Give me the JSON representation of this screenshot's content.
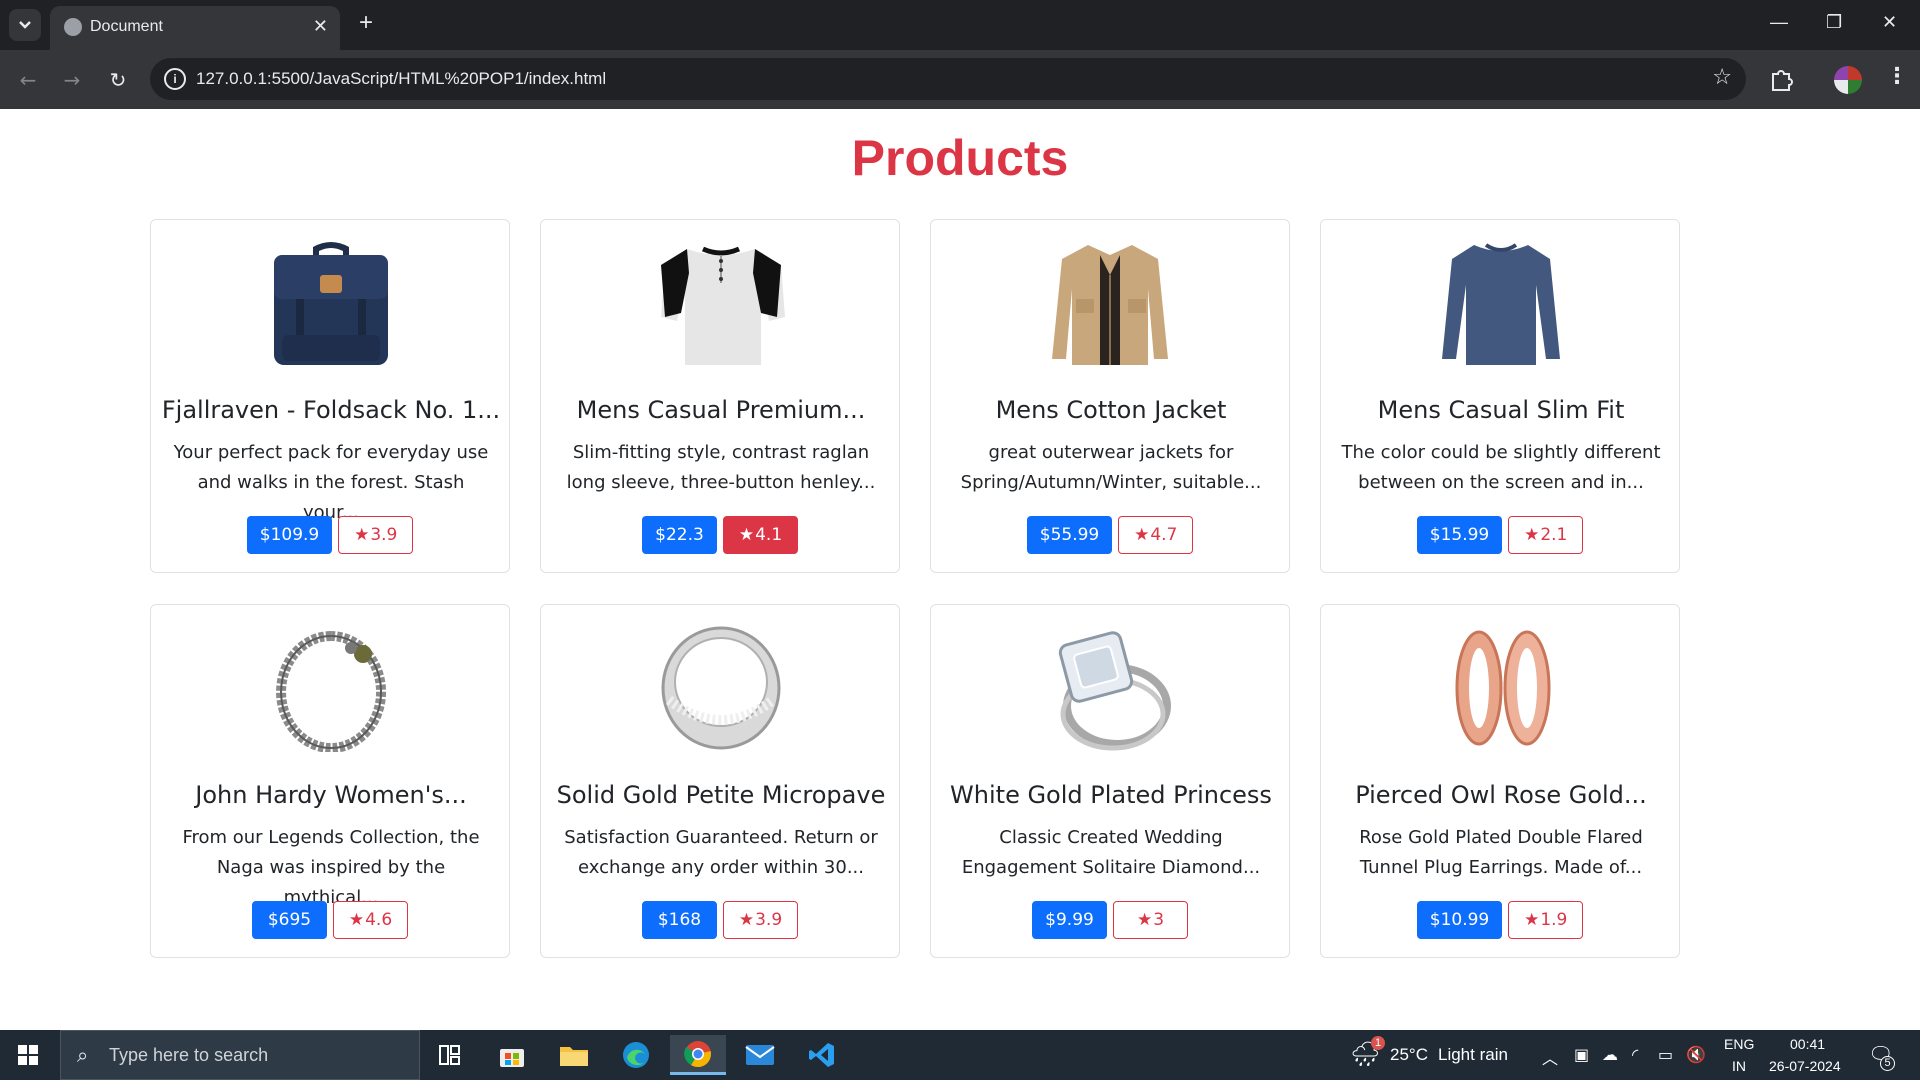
{
  "browser": {
    "tab_title": "Document",
    "url": "127.0.0.1:5500/JavaScript/HTML%20POP1/index.html"
  },
  "page": {
    "title": "Products"
  },
  "products": [
    {
      "title": "Fjallraven - Foldsack No. 1...",
      "desc": "Your perfect pack for everyday use and walks in the forest. Stash your...",
      "price": "$109.9",
      "rating": "3.9",
      "rating_active": false,
      "image": "backpack"
    },
    {
      "title": "Mens Casual Premium...",
      "desc": "Slim-fitting style, contrast raglan long sleeve, three-button henley...",
      "price": "$22.3",
      "rating": "4.1",
      "rating_active": true,
      "image": "henley-shirt"
    },
    {
      "title": "Mens Cotton Jacket",
      "desc": "great outerwear jackets for Spring/Autumn/Winter, suitable...",
      "price": "$55.99",
      "rating": "4.7",
      "rating_active": false,
      "image": "jacket"
    },
    {
      "title": "Mens Casual Slim Fit",
      "desc": "The color could be slightly different between on the screen and in...",
      "price": "$15.99",
      "rating": "2.1",
      "rating_active": false,
      "image": "long-sleeve-shirt"
    },
    {
      "title": "John Hardy Women's...",
      "desc": "From our Legends Collection, the Naga was inspired by the mythical...",
      "price": "$695",
      "rating": "4.6",
      "rating_active": false,
      "image": "bracelet"
    },
    {
      "title": "Solid Gold Petite Micropave",
      "desc": "Satisfaction Guaranteed. Return or exchange any order within 30...",
      "price": "$168",
      "rating": "3.9",
      "rating_active": false,
      "image": "silver-ring"
    },
    {
      "title": "White Gold Plated Princess",
      "desc": "Classic Created Wedding Engagement Solitaire Diamond...",
      "price": "$9.99",
      "rating": "3",
      "rating_active": false,
      "image": "diamond-ring"
    },
    {
      "title": "Pierced Owl Rose Gold...",
      "desc": "Rose Gold Plated Double Flared Tunnel Plug Earrings. Made of...",
      "price": "$10.99",
      "rating": "1.9",
      "rating_active": false,
      "image": "rose-gold-plugs"
    }
  ],
  "taskbar": {
    "search_placeholder": "Type here to search",
    "weather_temp": "25°C",
    "weather_desc": "Light rain",
    "weather_badge": "1",
    "lang_top": "ENG",
    "lang_bottom": "IN",
    "time": "00:41",
    "date": "26-07-2024",
    "notification_count": "5"
  },
  "colors": {
    "accent_red": "#dc3545",
    "accent_blue": "#0d6efd"
  }
}
